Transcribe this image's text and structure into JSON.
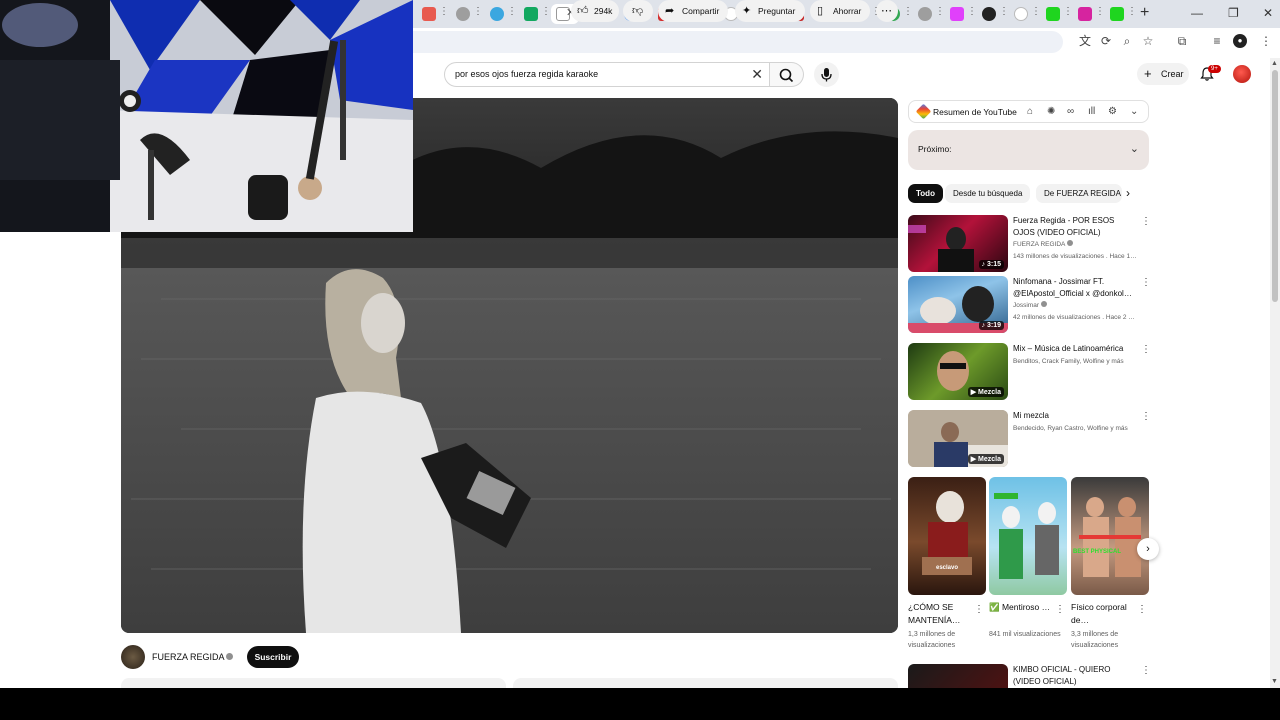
{
  "browser": {
    "tab_count_visible": 22,
    "new_tab_label": "+",
    "window_controls": [
      "—",
      "❐",
      "✕"
    ]
  },
  "header": {
    "search_value": "por esos ojos fuerza regida karaoke",
    "create_label": "Crear",
    "notifications_badge": "9+"
  },
  "video": {
    "channel_name": "FUERZA REGIDA",
    "subscribe_label": "Suscribir",
    "likes": "294k",
    "share_label": "Compartir",
    "ask_label": "Preguntar",
    "save_label": "Ahorrar"
  },
  "sidebar": {
    "summary_label": "Resumen de YouTube",
    "up_next_label": "Próximo:",
    "chips": [
      "Todo",
      "Desde tu búsqueda",
      "De FUERZA REGIDA"
    ],
    "recommendations": [
      {
        "title": "Fuerza Regida - POR ESOS OJOS (VIDEO OFICIAL)",
        "channel": "FUERZA REGIDA",
        "meta": "143 millones de visualizaciones . Hace 1…",
        "duration": "3:15"
      },
      {
        "title": "Ninfomana - Jossimar FT. @ElApostol_Official x @donkol…",
        "channel": "Jossimar",
        "meta": "42 millones de visualizaciones . Hace 2 …",
        "duration": "3:19"
      },
      {
        "title": "Mix – Música de Latinoamérica",
        "channel": "Benditos, Crack Family, Wolfine y más",
        "duration": "Mezcla"
      },
      {
        "title": "Mi mezcla",
        "channel": "Bendecido, Ryan Castro, Wolfine y más",
        "duration": "Mezcla"
      }
    ],
    "shorts": [
      {
        "title": "¿CÓMO SE MANTENÍA…",
        "views": "1,3 millones de visualizaciones",
        "overlay": "esclavo"
      },
      {
        "title": "✅ Mentiroso …",
        "views": "841 mil visualizaciones",
        "overlay": ""
      },
      {
        "title": "Físico corporal de…",
        "views": "3,3 millones de visualizaciones",
        "overlay": "BEST PHYSICAL"
      }
    ],
    "last_rec": {
      "title": "KIMBO OFICIAL - QUIERO (VIDEO OFICIAL)"
    }
  },
  "colors": {
    "subscribe_bg": "#0f0f0f",
    "chip_selected": "#0f0f0f",
    "up_next_bg": "#ece5e3",
    "badge": "#cc0000"
  }
}
